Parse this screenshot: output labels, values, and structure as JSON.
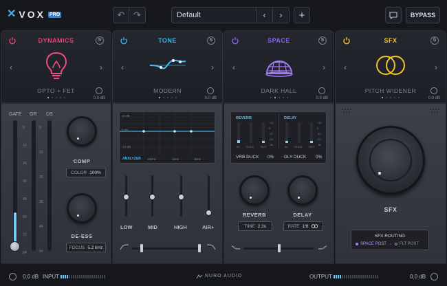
{
  "app": {
    "logo_text": "VOX",
    "logo_badge": "PRO"
  },
  "topbar": {
    "undo_icon": "↶",
    "redo_icon": "↷",
    "preset_name": "Default",
    "prev_icon": "‹",
    "next_icon": "›",
    "add_icon": "+",
    "bypass_label": "BYPASS"
  },
  "modules": [
    {
      "title": "DYNAMICS",
      "color": "#e8417a",
      "preset": "OPTO + FET",
      "gain": "0.0 dB",
      "icon": "lightbulb-icon",
      "s_label": "S"
    },
    {
      "title": "TONE",
      "color": "#38b6ec",
      "preset": "MODERN",
      "gain": "0.0 dB",
      "icon": "eq-curve-icon",
      "s_label": "S"
    },
    {
      "title": "SPACE",
      "color": "#8d62f2",
      "preset": "DARK HALL",
      "gain": "0.0 dB",
      "icon": "dome-icon",
      "s_label": "S"
    },
    {
      "title": "SFX",
      "color": "#f5c528",
      "preset": "PITCH WIDENER",
      "gain": "0.0 dB",
      "icon": "overlap-circles-icon",
      "s_label": "S"
    }
  ],
  "dynamics": {
    "meter_labels": [
      "GATE",
      "GR",
      "DS"
    ],
    "scale": [
      "0",
      "12",
      "24",
      "36",
      "48",
      "60",
      "72",
      "84"
    ],
    "ds_scale": [
      "0",
      "10",
      "20",
      "30",
      "40",
      "50"
    ],
    "gate_level": 0.25,
    "comp_label": "COMP",
    "color_label": "COLOR",
    "color_value": "100%",
    "deess_label": "DE-ESS",
    "focus_label": "FOCUS",
    "focus_value": "5.2 kHz"
  },
  "tone": {
    "db_labels": [
      "12 dB",
      "0 dB",
      "-12 dB"
    ],
    "analyzer_label": "ANALYZER",
    "freq_labels": [
      "180Hz",
      "1kHz",
      "3kHz"
    ],
    "sliders": [
      "LOW",
      "MID",
      "HIGH",
      "AIR+"
    ]
  },
  "space": {
    "reverb_tab": "REVERB",
    "delay_tab": "DELAY",
    "small_labels": [
      "IN",
      "DUCK",
      "OUT"
    ],
    "scale": [
      "+12",
      "0",
      "-12",
      "-24",
      "-36"
    ],
    "vrb_duck_label": "VRB DUCK",
    "vrb_duck_value": "0%",
    "dly_duck_label": "DLY DUCK",
    "dly_duck_value": "0%",
    "reverb_label": "REVERB",
    "delay_label": "DELAY",
    "time_label": "TIME",
    "time_value": "2.3s",
    "rate_label": "RATE",
    "rate_value": "1/8"
  },
  "sfx": {
    "knob_label": "SFX",
    "routing_title": "SFX ROUTING",
    "route_a": "SPACE POST",
    "route_arrow": "→",
    "route_b": "FLT POST"
  },
  "bottom": {
    "input_gain": "0.0 dB",
    "input_label": "INPUT",
    "brand": "NURO AUDIO",
    "output_label": "OUTPUT",
    "output_gain": "0.0 dB"
  }
}
